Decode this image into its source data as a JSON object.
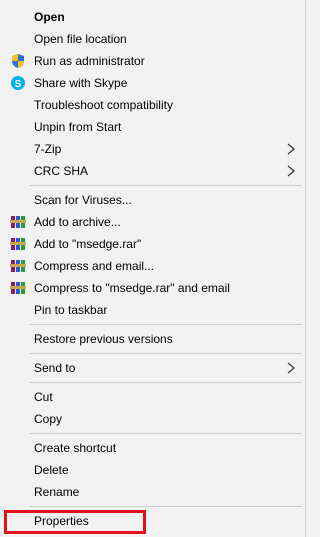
{
  "menu": {
    "items": [
      {
        "id": "open",
        "label": "Open",
        "bold": true
      },
      {
        "id": "open-file-location",
        "label": "Open file location"
      },
      {
        "id": "run-as-admin",
        "label": "Run as administrator",
        "icon": "uac-shield-icon"
      },
      {
        "id": "share-with-skype",
        "label": "Share with Skype",
        "icon": "skype-icon"
      },
      {
        "id": "troubleshoot-compatibility",
        "label": "Troubleshoot compatibility"
      },
      {
        "id": "unpin-from-start",
        "label": "Unpin from Start"
      },
      {
        "id": "7zip",
        "label": "7-Zip",
        "submenu": true
      },
      {
        "id": "crc-sha",
        "label": "CRC SHA",
        "submenu": true
      },
      {
        "id": "scan-for-viruses",
        "label": "Scan for Viruses..."
      },
      {
        "id": "add-to-archive",
        "label": "Add to archive...",
        "icon": "winrar-icon"
      },
      {
        "id": "add-to-msedge-rar",
        "label": "Add to \"msedge.rar\"",
        "icon": "winrar-icon"
      },
      {
        "id": "compress-and-email",
        "label": "Compress and email...",
        "icon": "winrar-icon"
      },
      {
        "id": "compress-to-msedge-rar-and-email",
        "label": "Compress to \"msedge.rar\" and email",
        "icon": "winrar-icon"
      },
      {
        "id": "pin-to-taskbar",
        "label": "Pin to taskbar"
      },
      {
        "id": "restore-previous-versions",
        "label": "Restore previous versions"
      },
      {
        "id": "send-to",
        "label": "Send to",
        "submenu": true
      },
      {
        "id": "cut",
        "label": "Cut"
      },
      {
        "id": "copy",
        "label": "Copy"
      },
      {
        "id": "create-shortcut",
        "label": "Create shortcut"
      },
      {
        "id": "delete",
        "label": "Delete"
      },
      {
        "id": "rename",
        "label": "Rename"
      },
      {
        "id": "properties",
        "label": "Properties",
        "highlighted": true
      }
    ]
  },
  "colors": {
    "background": "#f2f2f2",
    "separator": "#cbcbcb",
    "highlight_border": "#e2111d",
    "skype_blue": "#00aff0"
  }
}
